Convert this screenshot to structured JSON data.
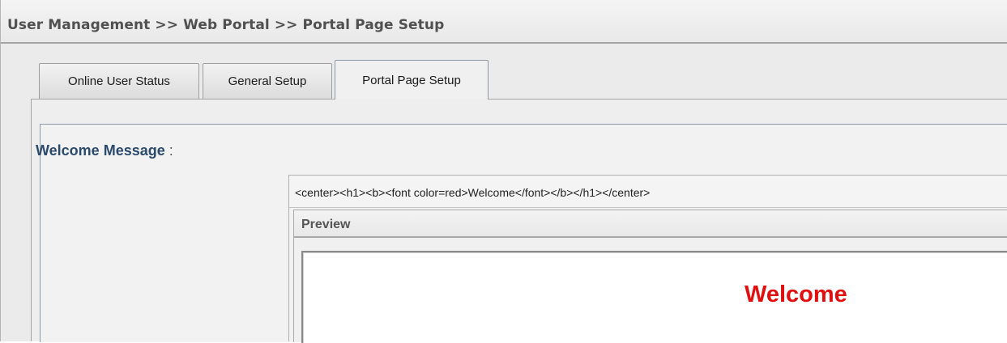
{
  "breadcrumb": {
    "text": "User Management >> Web Portal >> Portal Page Setup"
  },
  "tabs": [
    {
      "label": "Online User Status",
      "active": false
    },
    {
      "label": "General Setup",
      "active": false
    },
    {
      "label": "Portal Page Setup",
      "active": true
    }
  ],
  "form": {
    "welcome_message": {
      "label": "Welcome Message",
      "colon": " :",
      "source_value": "<center><h1><b><font color=red>Welcome</font></b></h1></center>",
      "preview_title": "Preview",
      "preview_text": "Welcome"
    }
  },
  "colors": {
    "label_color": "#2b4a6b",
    "welcome_color": "#e01010",
    "panel_border": "#8d98a8"
  }
}
